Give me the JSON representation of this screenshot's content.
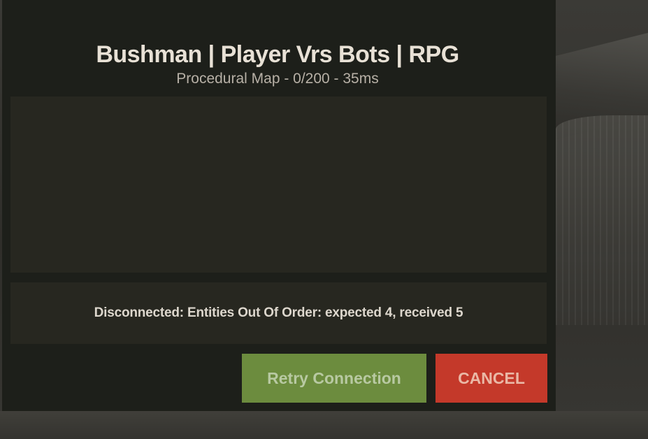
{
  "server": {
    "name": "Bushman | Player Vrs Bots | RPG",
    "info": "Procedural Map - 0/200 - 35ms"
  },
  "status": {
    "message": "Disconnected: Entities Out Of Order: expected 4, received 5"
  },
  "buttons": {
    "retry_label": "Retry Connection",
    "cancel_label": "CANCEL"
  },
  "colors": {
    "panel_bg": "#1d1f1a",
    "inner_bg": "#272720",
    "retry_green": "#6c8c3e",
    "cancel_red": "#c4392a"
  }
}
